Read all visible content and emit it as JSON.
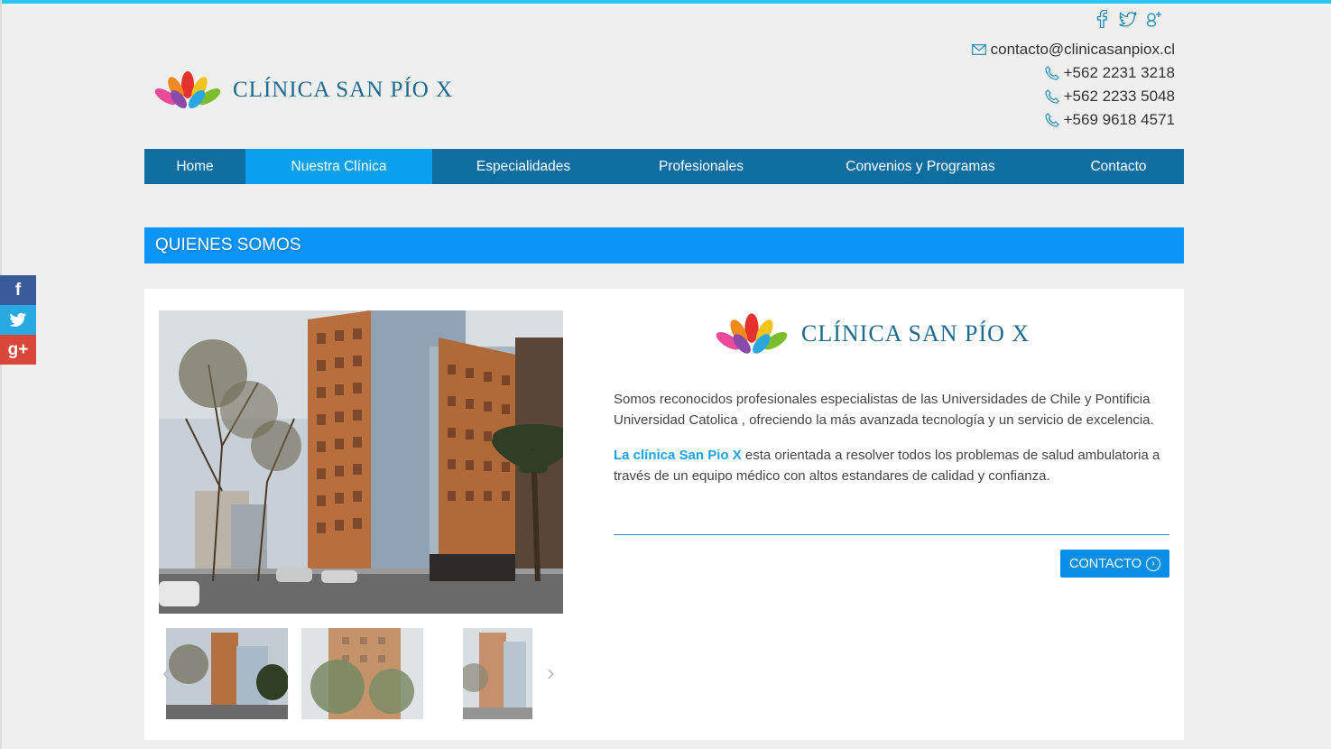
{
  "brand": {
    "name": "CLÍNICA SAN PÍO X"
  },
  "header_social": [
    "facebook-icon",
    "twitter-icon",
    "google-plus-icon"
  ],
  "contact": {
    "email": "contacto@clinicasanpiox.cl",
    "phones": [
      "+562 2231 3218",
      "+562 2233 5048",
      "+569 9618 4571"
    ]
  },
  "nav": {
    "items": [
      {
        "label": "Home",
        "active": false
      },
      {
        "label": "Nuestra Clínica",
        "active": true
      },
      {
        "label": "Especialidades",
        "active": false
      },
      {
        "label": "Profesionales",
        "active": false
      },
      {
        "label": "Convenios y Programas",
        "active": false
      },
      {
        "label": "Contacto",
        "active": false
      }
    ]
  },
  "section": {
    "title": "QUIENES SOMOS"
  },
  "content": {
    "paragraph1": "Somos reconocidos profesionales especialistas de las Universidades de Chile y Pontificia Universidad Catolica , ofreciendo la más avanzada tecnología y un servicio de excelencia.",
    "paragraph2_highlight": "La clínica San Pio X",
    "paragraph2_rest": " esta orientada a resolver todos los problemas de salud ambulatoria a través de un equipo médico con altos estandares de calidad y confianza.",
    "button_label": "CONTACTO"
  },
  "floating_share": [
    "f",
    "t",
    "g+"
  ],
  "colors": {
    "accent_top": "#2cc5f2",
    "nav_bg": "#0f6ea0",
    "nav_active": "#0aa0ee",
    "section_bar": "#0a95f7",
    "button": "#0a8fe8",
    "highlight": "#17a2e6"
  }
}
